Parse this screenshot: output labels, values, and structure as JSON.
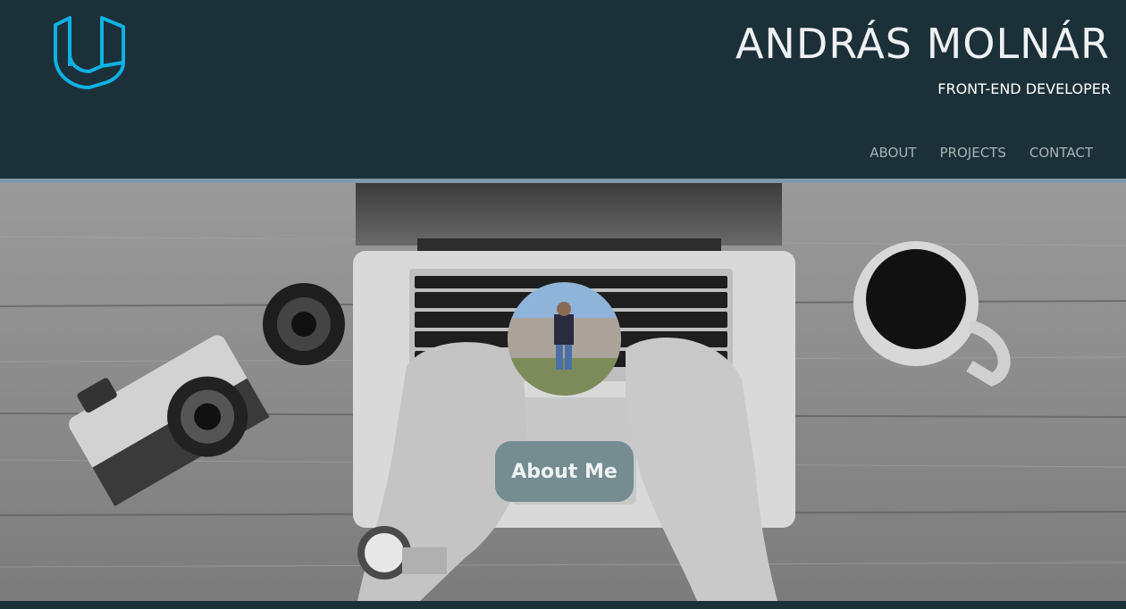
{
  "header": {
    "name": "ANDRÁS MOLNÁR",
    "role": "FRONT-END DEVELOPER",
    "logo_icon": "udacity-logo-icon",
    "logo_color": "#02b3e4",
    "background": "#1b3039"
  },
  "nav": {
    "items": [
      {
        "label": "ABOUT"
      },
      {
        "label": "PROJECTS"
      },
      {
        "label": "CONTACT"
      }
    ]
  },
  "hero": {
    "image_description_icon": "desk-laptop-camera-coffee-photo",
    "avatar_icon": "profile-photo-avatar",
    "about_button_label": "About Me"
  }
}
